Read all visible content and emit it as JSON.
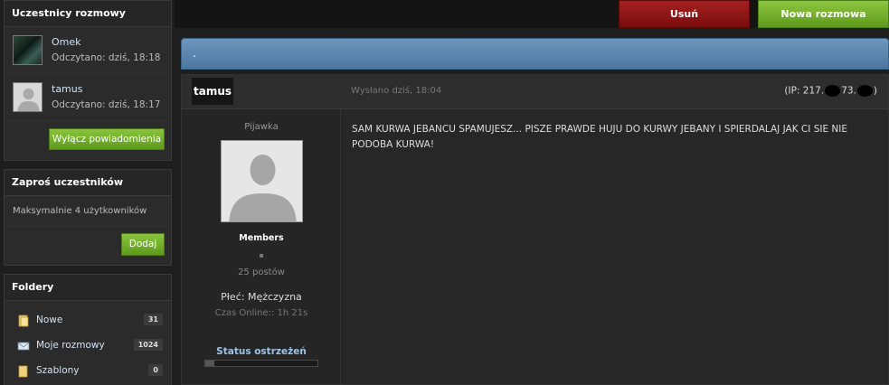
{
  "sidebar": {
    "participants": {
      "title": "Uczestnicy rozmowy",
      "items": [
        {
          "name": "Omek",
          "read": "Odczytano: dziś, 18:18"
        },
        {
          "name": "tamus",
          "read": "Odczytano: dziś, 18:17"
        }
      ],
      "disable_notifications_label": "Wyłącz powiadomienia"
    },
    "invite": {
      "title": "Zaproś uczestników",
      "hint": "Maksymalnie 4 użytkowników",
      "add_label": "Dodaj"
    },
    "folders": {
      "title": "Foldery",
      "items": [
        {
          "label": "Nowe",
          "count": "31",
          "icon": "folder-icon"
        },
        {
          "label": "Moje rozmowy",
          "count": "1024",
          "icon": "envelope-icon"
        },
        {
          "label": "Szablony",
          "count": "0",
          "icon": "folder-icon"
        }
      ]
    }
  },
  "toolbar": {
    "delete_label": "Usuń",
    "new_label": "Nowa rozmowa"
  },
  "topic": {
    "title": "."
  },
  "post": {
    "author": "tamus",
    "date": "Wysłano dziś, 18:04",
    "ip_prefix": "(IP: 217.",
    "ip_mid": "73.",
    "ip_suffix": ")",
    "author_title": "Pijawka",
    "group": "Members",
    "posts": "25 postów",
    "gender": "Płeć: Mężczyzna",
    "online": "Czas Online:: 1h 21s",
    "warn_title": "Status ostrzeżeń",
    "warn_level": 0.08,
    "body": "SAM KURWA JEBANCU SPAMUJESZ... PISZE PRAWDE HUJU DO KURWY JEBANY I SPIERDALAJ JAK CI SIE NIE PODOBA KURWA!"
  },
  "colors": {
    "delete": "#8f1515",
    "green": "#77b02c",
    "topic": "#5b84ad",
    "link": "#cfe3f5"
  }
}
